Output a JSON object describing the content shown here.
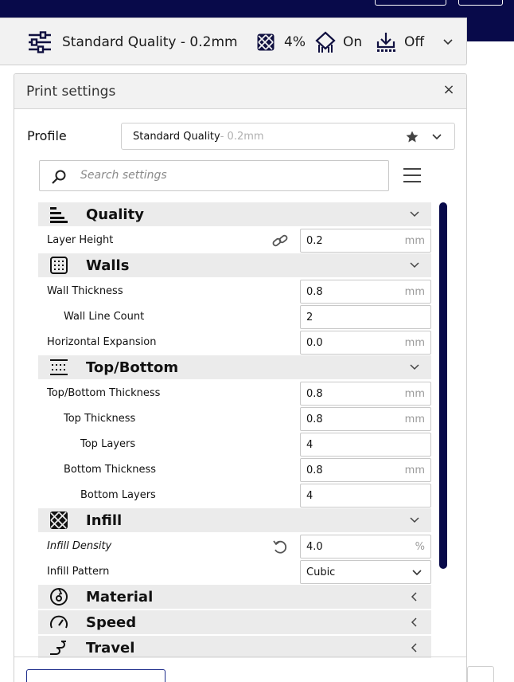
{
  "setup_bar": {
    "profile": "Standard Quality - 0.2mm",
    "infill": "4%",
    "support": "On",
    "adhesion": "Off"
  },
  "panel": {
    "title": "Print settings",
    "close_glyph": "×",
    "profile_label": "Profile",
    "profile_name": "Standard Quality",
    "profile_suffix": " - 0.2mm",
    "search_placeholder": "Search settings"
  },
  "categories": {
    "quality": {
      "label": "Quality"
    },
    "walls": {
      "label": "Walls"
    },
    "topbottom": {
      "label": "Top/Bottom"
    },
    "infill": {
      "label": "Infill"
    },
    "material": {
      "label": "Material"
    },
    "speed": {
      "label": "Speed"
    },
    "travel": {
      "label": "Travel"
    }
  },
  "settings": {
    "layer_height": {
      "label": "Layer Height",
      "value": "0.2",
      "unit": "mm"
    },
    "wall_thickness": {
      "label": "Wall Thickness",
      "value": "0.8",
      "unit": "mm"
    },
    "wall_line_count": {
      "label": "Wall Line Count",
      "value": "2"
    },
    "horizontal_expansion": {
      "label": "Horizontal Expansion",
      "value": "0.0",
      "unit": "mm"
    },
    "topbottom_thickness": {
      "label": "Top/Bottom Thickness",
      "value": "0.8",
      "unit": "mm"
    },
    "top_thickness": {
      "label": "Top Thickness",
      "value": "0.8",
      "unit": "mm"
    },
    "top_layers": {
      "label": "Top Layers",
      "value": "4"
    },
    "bottom_thickness": {
      "label": "Bottom Thickness",
      "value": "0.8",
      "unit": "mm"
    },
    "bottom_layers": {
      "label": "Bottom Layers",
      "value": "4"
    },
    "infill_density": {
      "label": "Infill Density",
      "value": "4.0",
      "unit": "%"
    },
    "infill_pattern": {
      "label": "Infill Pattern",
      "value": "Cubic"
    }
  },
  "colors": {
    "accent": "#080a4a",
    "link": "#1b2a8a",
    "category_bg": "#ebebeb"
  }
}
